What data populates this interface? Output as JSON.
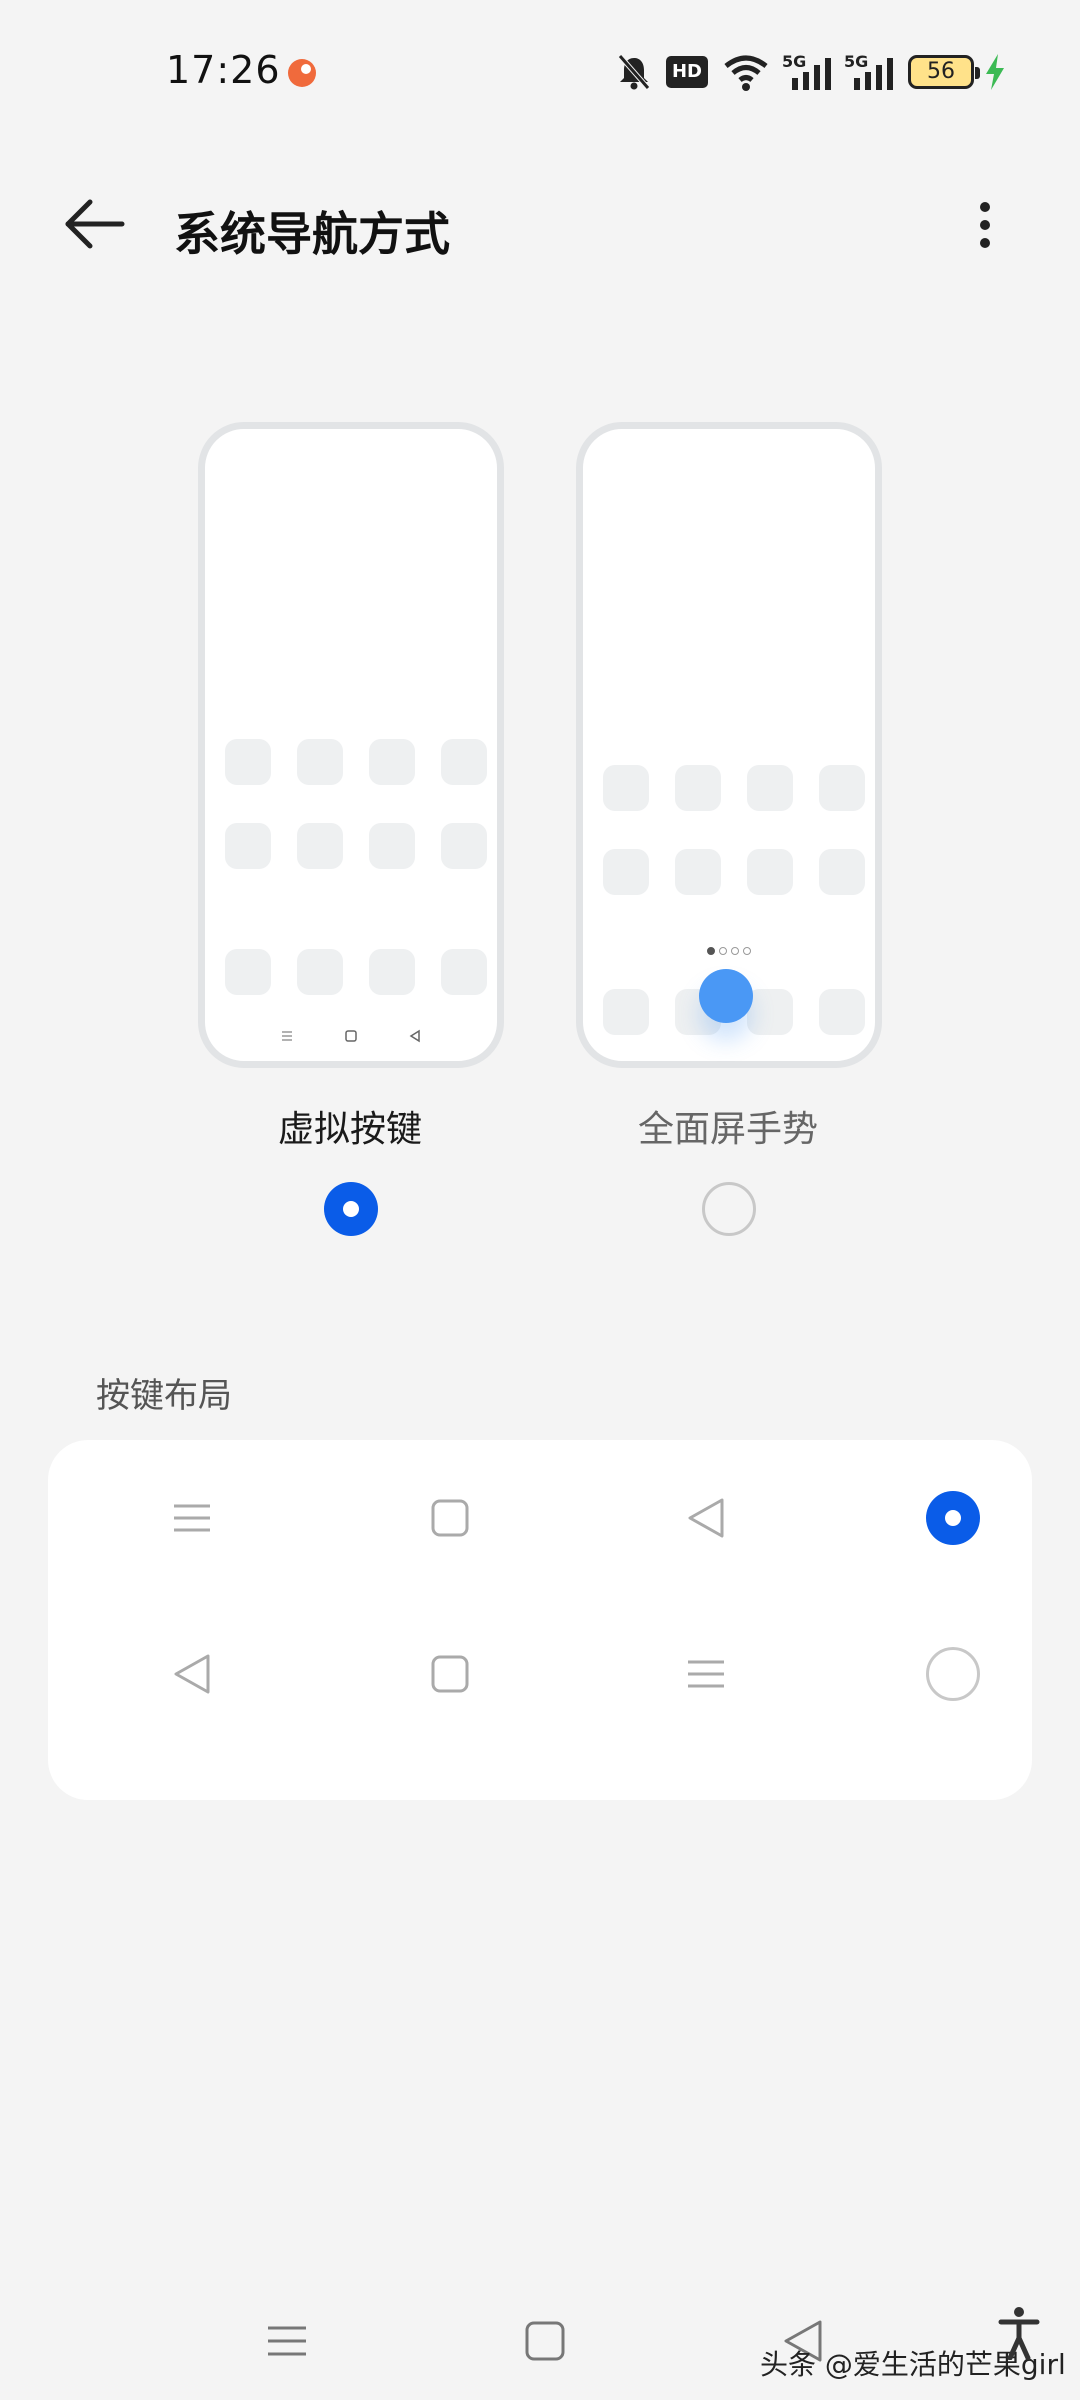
{
  "status_bar": {
    "time": "17:26",
    "icons": [
      "app-notification-icon",
      "mute-icon",
      "hd-icon",
      "wifi-icon",
      "signal-5g-icon",
      "signal-5g-icon"
    ],
    "hd_label": "HD",
    "net_label_1": "5G",
    "net_label_2": "5G",
    "battery_level": "56",
    "charging": true,
    "colors": {
      "app_notification": "#f06a3c",
      "charging": "#3cba54",
      "battery_fill": "#ffe28a"
    }
  },
  "app_bar": {
    "title": "系统导航方式"
  },
  "nav_modes": [
    {
      "label": "虚拟按键",
      "selected": true
    },
    {
      "label": "全面屏手势",
      "selected": false
    }
  ],
  "button_layout": {
    "section_title": "按键布局",
    "options": [
      {
        "icons": [
          "menu-icon",
          "home-square-icon",
          "back-triangle-icon"
        ],
        "selected": true
      },
      {
        "icons": [
          "back-triangle-icon",
          "home-square-icon",
          "menu-icon"
        ],
        "selected": false
      }
    ]
  },
  "system_nav": {
    "icons": [
      "menu-icon",
      "home-square-icon",
      "back-triangle-icon",
      "accessibility-icon"
    ]
  },
  "watermark": "头条 @爱生活的芒果girl",
  "accent_color": "#0a5ce8"
}
